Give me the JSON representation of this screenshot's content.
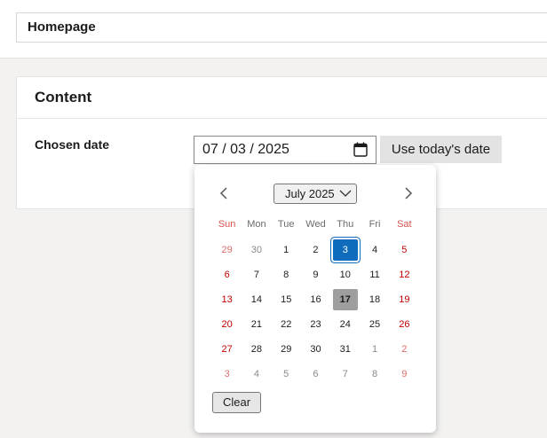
{
  "page": {
    "name_value": "Homepage"
  },
  "content": {
    "title": "Content",
    "field_label": "Chosen date",
    "date_value": "07 / 03 / 2025",
    "today_button": "Use today's date"
  },
  "picker": {
    "month_label": "July 2025",
    "weekdays": [
      "Sun",
      "Mon",
      "Tue",
      "Wed",
      "Thu",
      "Fri",
      "Sat"
    ],
    "weeks": [
      [
        {
          "d": "29",
          "other": true
        },
        {
          "d": "30",
          "other": true
        },
        {
          "d": "1"
        },
        {
          "d": "2"
        },
        {
          "d": "3",
          "selected": true
        },
        {
          "d": "4"
        },
        {
          "d": "5"
        }
      ],
      [
        {
          "d": "6"
        },
        {
          "d": "7"
        },
        {
          "d": "8"
        },
        {
          "d": "9"
        },
        {
          "d": "10"
        },
        {
          "d": "11"
        },
        {
          "d": "12"
        }
      ],
      [
        {
          "d": "13"
        },
        {
          "d": "14"
        },
        {
          "d": "15"
        },
        {
          "d": "16"
        },
        {
          "d": "17",
          "today": true
        },
        {
          "d": "18"
        },
        {
          "d": "19"
        }
      ],
      [
        {
          "d": "20"
        },
        {
          "d": "21"
        },
        {
          "d": "22"
        },
        {
          "d": "23"
        },
        {
          "d": "24"
        },
        {
          "d": "25"
        },
        {
          "d": "26"
        }
      ],
      [
        {
          "d": "27"
        },
        {
          "d": "28"
        },
        {
          "d": "29"
        },
        {
          "d": "30"
        },
        {
          "d": "31"
        },
        {
          "d": "1",
          "other": true
        },
        {
          "d": "2",
          "other": true
        }
      ],
      [
        {
          "d": "3",
          "other": true
        },
        {
          "d": "4",
          "other": true
        },
        {
          "d": "5",
          "other": true
        },
        {
          "d": "6",
          "other": true
        },
        {
          "d": "7",
          "other": true
        },
        {
          "d": "8",
          "other": true
        },
        {
          "d": "9",
          "other": true
        }
      ]
    ],
    "clear_label": "Clear"
  },
  "colors": {
    "accent": "#0f6cbd",
    "weekend": "#c40000",
    "today_bg": "#9e9e9e"
  },
  "icons": {
    "calendar": "calendar-icon",
    "prev": "chevron-left-icon",
    "next": "chevron-right-icon",
    "dropdown": "chevron-down-icon"
  }
}
